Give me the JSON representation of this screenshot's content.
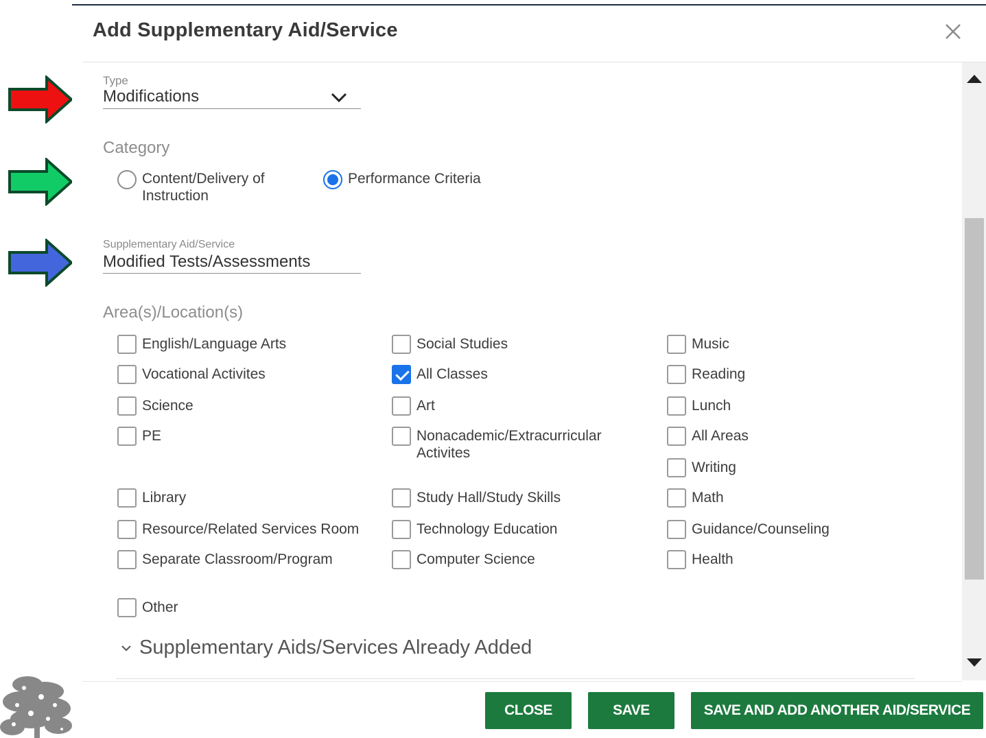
{
  "dialog": {
    "title": "Add Supplementary Aid/Service"
  },
  "type_field": {
    "label": "Type",
    "value": "Modifications"
  },
  "category": {
    "label": "Category",
    "options": [
      {
        "label": "Content/Delivery of Instruction",
        "selected": false
      },
      {
        "label": "Performance Criteria",
        "selected": true
      }
    ]
  },
  "aid_service": {
    "label": "Supplementary Aid/Service",
    "value": "Modified Tests/Assessments"
  },
  "areas": {
    "label": "Area(s)/Location(s)",
    "items": [
      {
        "label": "English/Language Arts",
        "checked": false
      },
      {
        "label": "Social Studies",
        "checked": false
      },
      {
        "label": "Music",
        "checked": false
      },
      {
        "label": "Vocational Activites",
        "checked": false
      },
      {
        "label": "All Classes",
        "checked": true
      },
      {
        "label": "Reading",
        "checked": false
      },
      {
        "label": "Science",
        "checked": false
      },
      {
        "label": "Art",
        "checked": false
      },
      {
        "label": "Lunch",
        "checked": false
      },
      {
        "label": "PE",
        "checked": false
      },
      {
        "label": "Nonacademic/Extracurricular Activites",
        "checked": false
      },
      {
        "label": "All Areas",
        "checked": false
      },
      {
        "label": "Writing",
        "checked": false
      },
      {
        "label": "Library",
        "checked": false
      },
      {
        "label": "Study Hall/Study Skills",
        "checked": false
      },
      {
        "label": "Math",
        "checked": false
      },
      {
        "label": "Resource/Related Services Room",
        "checked": false
      },
      {
        "label": "Technology Education",
        "checked": false
      },
      {
        "label": "Guidance/Counseling",
        "checked": false
      },
      {
        "label": "Separate Classroom/Program",
        "checked": false
      },
      {
        "label": "Computer Science",
        "checked": false
      },
      {
        "label": "Health",
        "checked": false
      },
      {
        "label": "Other",
        "checked": false
      }
    ]
  },
  "already_added": {
    "label": "Supplementary Aids/Services Already Added"
  },
  "buttons": {
    "close": "CLOSE",
    "save": "SAVE",
    "save_add": "SAVE AND ADD ANOTHER AID/SERVICE"
  },
  "colors": {
    "primary_button": "#1c7a3e",
    "selection_blue": "#1a73e8",
    "arrow_red": "#ee1111",
    "arrow_green": "#11cc66",
    "arrow_blue": "#4466dd",
    "arrow_outline": "#0b4a2a"
  },
  "icons": {
    "close": "close-icon",
    "dropdown": "chevron-down-icon",
    "expand": "chevron-down-icon",
    "scroll_up": "triangle-up-icon",
    "scroll_down": "triangle-down-icon"
  }
}
